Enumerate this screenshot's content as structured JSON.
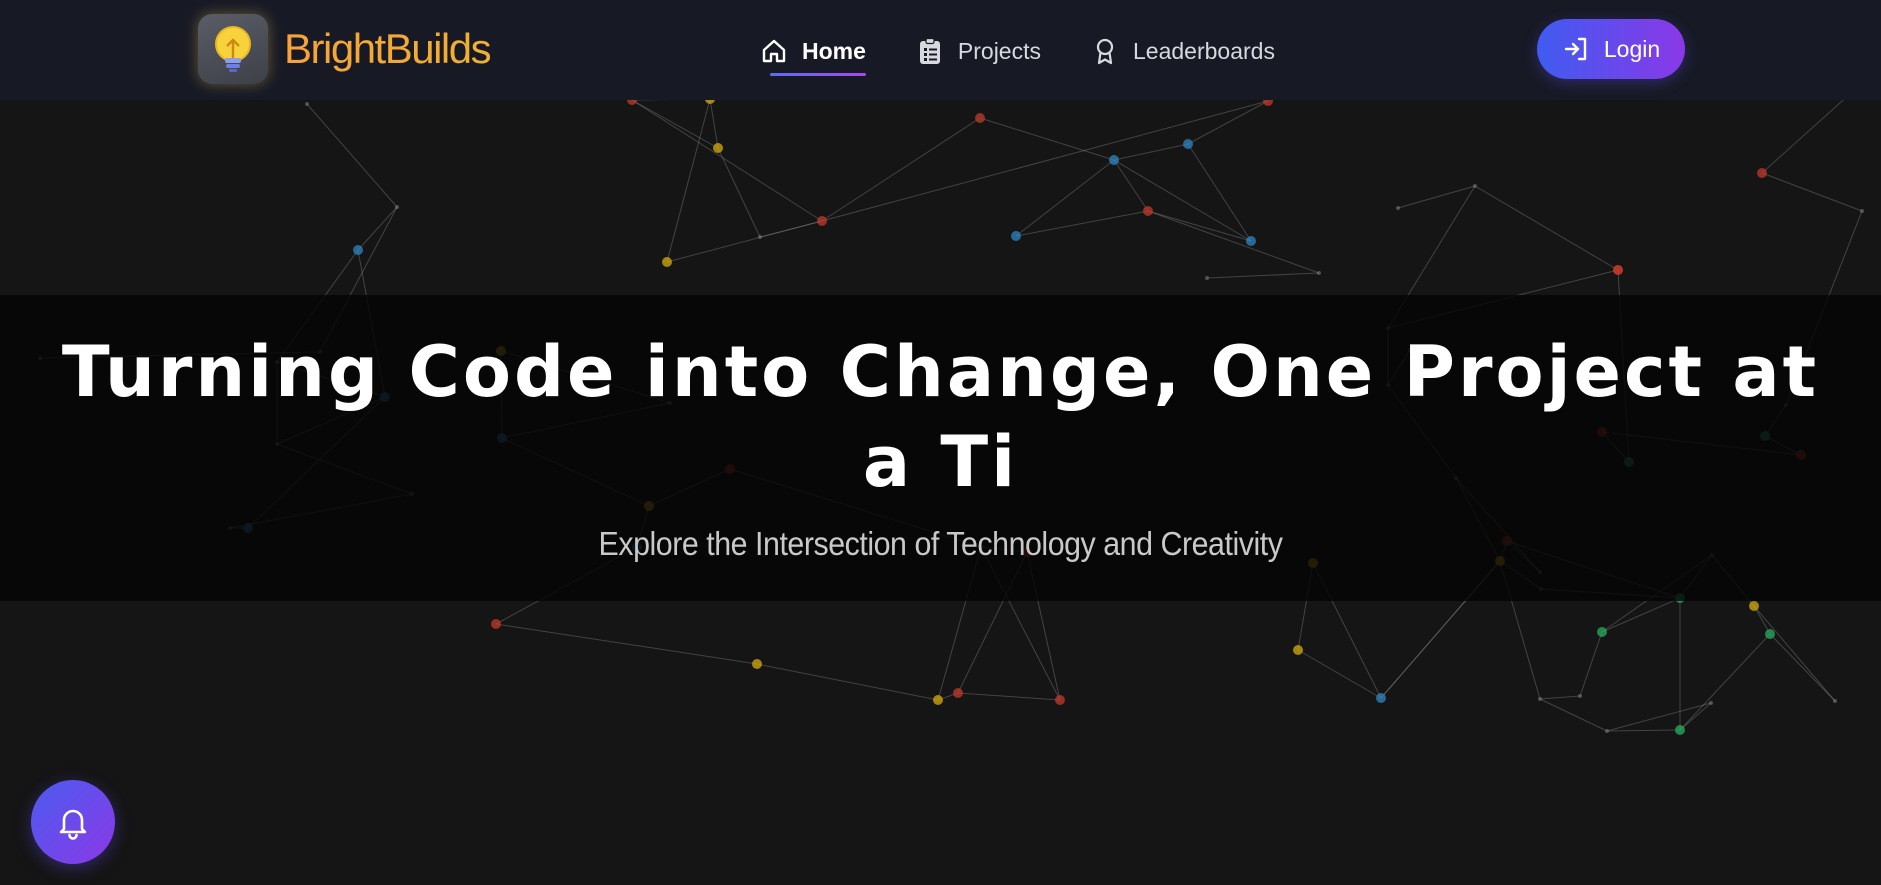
{
  "brand": {
    "name": "BrightBuilds",
    "logo_icon": "lightbulb-icon",
    "accent": "#f29a2e"
  },
  "nav": {
    "items": [
      {
        "label": "Home",
        "icon": "home-icon",
        "active": true
      },
      {
        "label": "Projects",
        "icon": "clipboard-list-icon",
        "active": false
      },
      {
        "label": "Leaderboards",
        "icon": "award-icon",
        "active": false
      }
    ],
    "login_label": "Login",
    "login_icon": "login-icon"
  },
  "hero": {
    "title": "Turning Code into Change, One Project at a Ti",
    "subtitle": "Explore the Intersection of Technology and Creativity"
  },
  "notifications": {
    "icon": "bell-icon"
  },
  "colors": {
    "navbar_bg": "#171a25",
    "page_bg": "#151515",
    "button_gradient_start": "#3f5cf0",
    "button_gradient_end": "#8a38e8",
    "node_colors": [
      "#c0392b",
      "#2e86c1",
      "#d4ac0d",
      "#27ae60"
    ]
  }
}
